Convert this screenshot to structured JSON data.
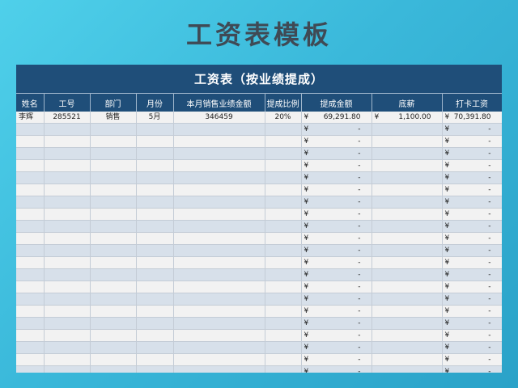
{
  "page_title": "工资表模板",
  "sheet_title": "工资表（按业绩提成）",
  "columns": [
    "姓名",
    "工号",
    "部门",
    "月份",
    "本月销售业绩金额",
    "提成比例",
    "提成金额",
    "底薪",
    "打卡工资"
  ],
  "currency_symbol": "¥",
  "empty_amount": "-",
  "rows": [
    {
      "name": "李辉",
      "id": "285521",
      "dept": "销售",
      "month": "5月",
      "sales": "346459",
      "rate": "20%",
      "commission": "69,291.80",
      "base": "1,100.00",
      "total": "70,391.80"
    }
  ],
  "empty_row_count": 21,
  "colors": {
    "header": "#1f4e79",
    "row_alt": "#d7e0ea",
    "row": "#f2f2f2"
  }
}
